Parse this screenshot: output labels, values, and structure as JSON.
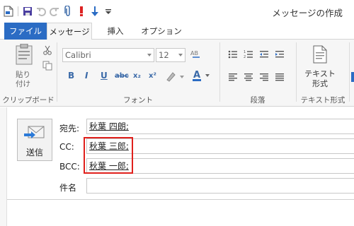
{
  "window": {
    "title": "メッセージの作成"
  },
  "tabs": [
    {
      "label": "ファイル"
    },
    {
      "label": "メッセージ"
    },
    {
      "label": "挿入"
    },
    {
      "label": "オプション"
    }
  ],
  "ribbon": {
    "clipboard": {
      "paste_label_1": "貼り",
      "paste_label_2": "付け",
      "group_label": "クリップボード"
    },
    "font": {
      "font_name": "Calibri",
      "font_size": "12",
      "group_label": "フォント"
    },
    "paragraph": {
      "group_label": "段落"
    },
    "text_format": {
      "button_line_1": "テキスト",
      "button_line_2": "形式",
      "group_label": "テキスト形式"
    }
  },
  "compose": {
    "send_label": "送信",
    "to_label": "宛先:",
    "to_value": "秋葉 四朗;",
    "cc_label": "CC:",
    "cc_value": "秋葉 三郎;",
    "bcc_label": "BCC:",
    "bcc_value": "秋葉 一郎;",
    "subject_label": "件名",
    "subject_value": ""
  },
  "colors": {
    "accent": "#2b6cc4",
    "highlight": "#e0201c",
    "ribbon_bg": "#f6f6f6"
  }
}
